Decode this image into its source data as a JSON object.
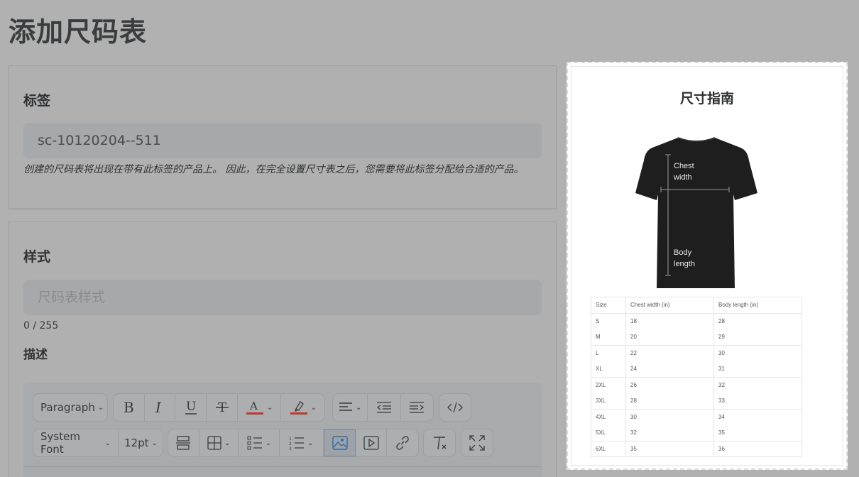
{
  "page": {
    "title": "添加尺码表"
  },
  "tags_card": {
    "heading": "标签",
    "tag_value": "sc-10120204--511",
    "help_text": "创建的尺码表将出现在带有此标签的产品上。 因此，在完全设置尺寸表之后，您需要将此标签分配给合适的产品。"
  },
  "style_card": {
    "heading": "样式",
    "style_placeholder": "尺码表样式",
    "style_value": "",
    "char_counter": "0 / 255",
    "description_heading": "描述"
  },
  "toolbar": {
    "block_format": "Paragraph",
    "font_family": "System Font",
    "font_size": "12pt",
    "text_color": "#c0392b",
    "highlight_color": "#c0392b",
    "row1_buttons": [
      "bold",
      "italic",
      "underline",
      "strikethrough",
      "text-color",
      "highlight",
      "align",
      "outdent",
      "indent",
      "source-code"
    ],
    "row2_buttons": [
      "page-break",
      "table",
      "bullet-list",
      "numbered-list",
      "image",
      "media",
      "link",
      "clear-formatting",
      "fullscreen"
    ],
    "active_button": "image"
  },
  "preview": {
    "title": "尺寸指南",
    "shirt_labels": {
      "chest": "Chest\nwidth",
      "body": "Body\nlength"
    },
    "table": {
      "headers": [
        "Size",
        "Chest width (in)",
        "Body length (in)"
      ],
      "rows": [
        [
          "S",
          "18",
          "28"
        ],
        [
          "M",
          "20",
          "29"
        ],
        [
          "L",
          "22",
          "30"
        ],
        [
          "XL",
          "24",
          "31"
        ],
        [
          "2XL",
          "26",
          "32"
        ],
        [
          "3XL",
          "28",
          "33"
        ],
        [
          "4XL",
          "30",
          "34"
        ],
        [
          "5XL",
          "32",
          "35"
        ],
        [
          "6XL",
          "35",
          "36"
        ]
      ]
    }
  }
}
